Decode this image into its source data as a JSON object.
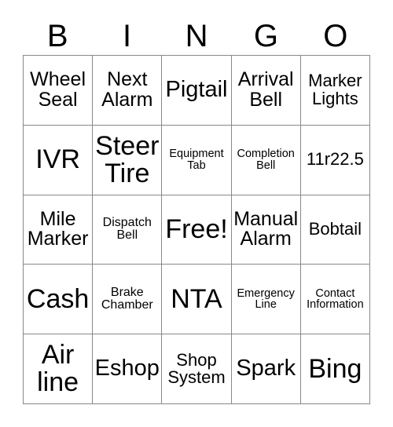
{
  "card": {
    "headers": [
      "B",
      "I",
      "N",
      "G",
      "O"
    ],
    "rows": [
      [
        {
          "text": "Wheel Seal",
          "size": "l"
        },
        {
          "text": "Next Alarm",
          "size": "l"
        },
        {
          "text": "Pigtail",
          "size": "xl"
        },
        {
          "text": "Arrival Bell",
          "size": "l"
        },
        {
          "text": "Marker Lights",
          "size": "m"
        }
      ],
      [
        {
          "text": "IVR",
          "size": "xxl"
        },
        {
          "text": "Steer Tire",
          "size": "xxl"
        },
        {
          "text": "Equipment Tab",
          "size": "xs"
        },
        {
          "text": "Completion Bell",
          "size": "xs"
        },
        {
          "text": "11r22.5",
          "size": "m"
        }
      ],
      [
        {
          "text": "Mile Marker",
          "size": "l"
        },
        {
          "text": "Dispatch Bell",
          "size": "s"
        },
        {
          "text": "Free!",
          "size": "xxl"
        },
        {
          "text": "Manual Alarm",
          "size": "l"
        },
        {
          "text": "Bobtail",
          "size": "m"
        }
      ],
      [
        {
          "text": "Cash",
          "size": "xxl"
        },
        {
          "text": "Brake Chamber",
          "size": "s"
        },
        {
          "text": "NTA",
          "size": "xxl"
        },
        {
          "text": "Emergency Line",
          "size": "xs"
        },
        {
          "text": "Contact Information",
          "size": "xs"
        }
      ],
      [
        {
          "text": "Air line",
          "size": "xxl"
        },
        {
          "text": "Eshop",
          "size": "xl"
        },
        {
          "text": "Shop System",
          "size": "m"
        },
        {
          "text": "Spark",
          "size": "xl"
        },
        {
          "text": "Bing",
          "size": "xxl"
        }
      ]
    ]
  },
  "style": {
    "border_color": "#888888",
    "text_color": "#000000",
    "background": "#ffffff"
  }
}
